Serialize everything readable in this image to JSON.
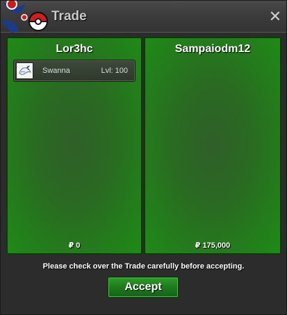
{
  "window": {
    "title": "Trade",
    "close_label": "✕"
  },
  "left_panel": {
    "player": "Lor3hc",
    "items": [
      {
        "name": "Swanna",
        "level": "Lvl: 100"
      }
    ],
    "money": "₽ 0"
  },
  "right_panel": {
    "player": "Sampaiodm12",
    "money": "₽ 175,000"
  },
  "footer": {
    "notice": "Please check over the Trade carefully before accepting.",
    "accept_label": "Accept"
  },
  "colors": {
    "panel_green": "#237d1b",
    "button_green": "#1e7a1b",
    "titlebar": "#3c3c3c"
  },
  "icons": {
    "logo": "pokeball-logo-icon",
    "item": "swanna-sprite-icon",
    "close": "close-icon"
  }
}
